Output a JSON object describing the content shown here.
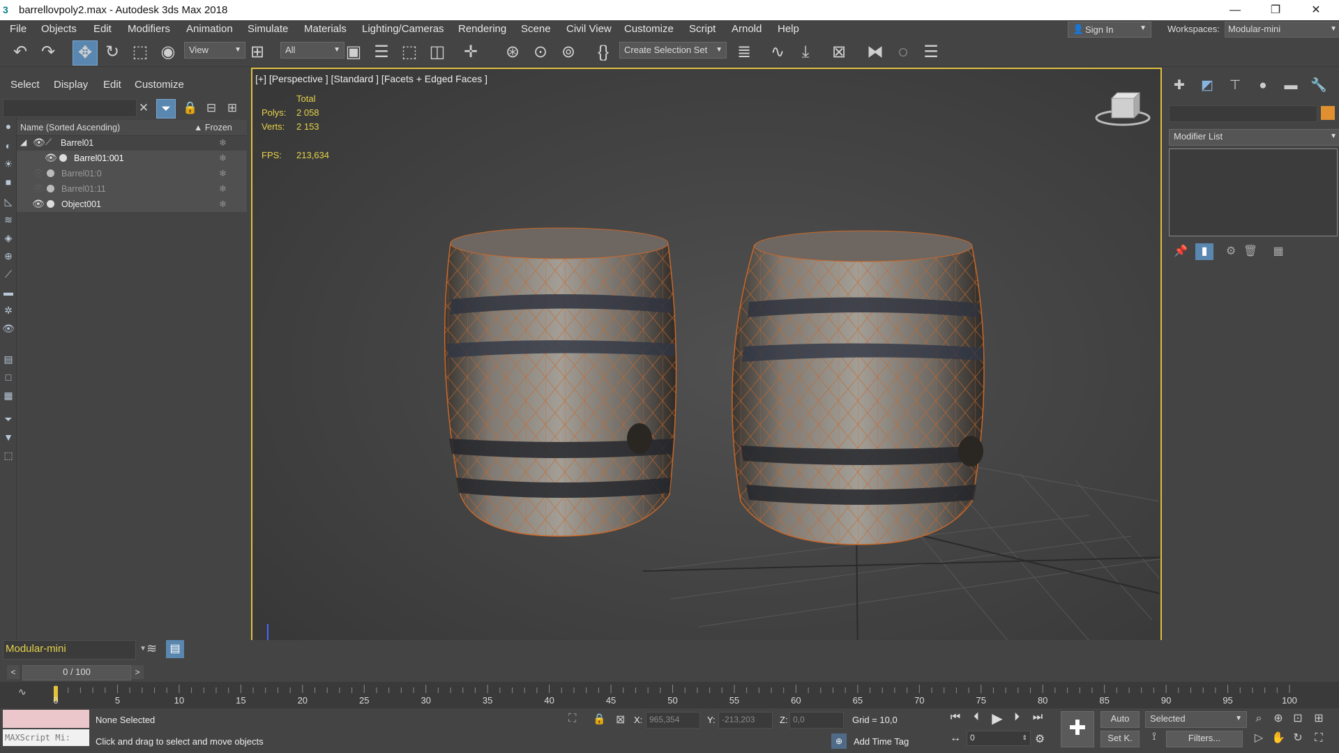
{
  "window": {
    "title": "barrellovpoly2.max - Autodesk 3ds Max 2018",
    "logo": "3",
    "controls": [
      "—",
      "❐",
      "✕"
    ]
  },
  "menu": {
    "items": [
      "File",
      "Objects",
      "Edit",
      "Modifiers",
      "Animation",
      "Simulate",
      "Materials",
      "Lighting/Cameras",
      "Rendering",
      "Scene",
      "Civil View",
      "Customize",
      "Script",
      "Arnold",
      "Help"
    ],
    "sign_in": "Sign In",
    "workspaces_label": "Workspaces:",
    "workspace_value": "Modular-mini"
  },
  "toolbar": {
    "view_dropdown": "View",
    "filter_dropdown": "All",
    "selection_set": "Create Selection Set"
  },
  "explorer": {
    "tabs": [
      "Select",
      "Display",
      "Edit",
      "Customize"
    ],
    "header_name": "Name (Sorted Ascending)",
    "header_frozen": "▲ Frozen",
    "rows": [
      {
        "name": "Barrel01"
      },
      {
        "name": "Barrel01:001"
      },
      {
        "name": "Barrel01:0"
      },
      {
        "name": "Barrel01:11"
      },
      {
        "name": "Object001"
      }
    ]
  },
  "viewport": {
    "label": "[+] [Perspective ] [Standard ] [Facets + Edged Faces ]",
    "stats": {
      "total_label": "Total",
      "polys_label": "Polys:",
      "polys_value": "2 058",
      "verts_label": "Verts:",
      "verts_value": "2 153",
      "fps_label": "FPS:",
      "fps_value": "213,634"
    }
  },
  "command_panel": {
    "modifier_list": "Modifier List"
  },
  "bottom": {
    "workspace_box": "Modular-mini",
    "time_slider": "0 / 100",
    "ticks": [
      "0",
      "5",
      "10",
      "15",
      "20",
      "25",
      "30",
      "35",
      "40",
      "45",
      "50",
      "55",
      "60",
      "65",
      "70",
      "75",
      "80",
      "85",
      "90",
      "95",
      "100"
    ],
    "maxscript_placeholder": "MAXScript Mi:",
    "status_selection": "None Selected",
    "status_prompt": "Click and drag to select and move objects",
    "x_label": "X:",
    "x_value": "965,354",
    "y_label": "Y:",
    "y_value": "-213,203",
    "z_label": "Z:",
    "z_value": "0,0",
    "grid": "Grid = 10,0",
    "add_time_tag": "Add Time Tag",
    "auto": "Auto",
    "set_key": "Set K.",
    "selected": "Selected",
    "filters": "Filters...",
    "frame_value": "0"
  }
}
